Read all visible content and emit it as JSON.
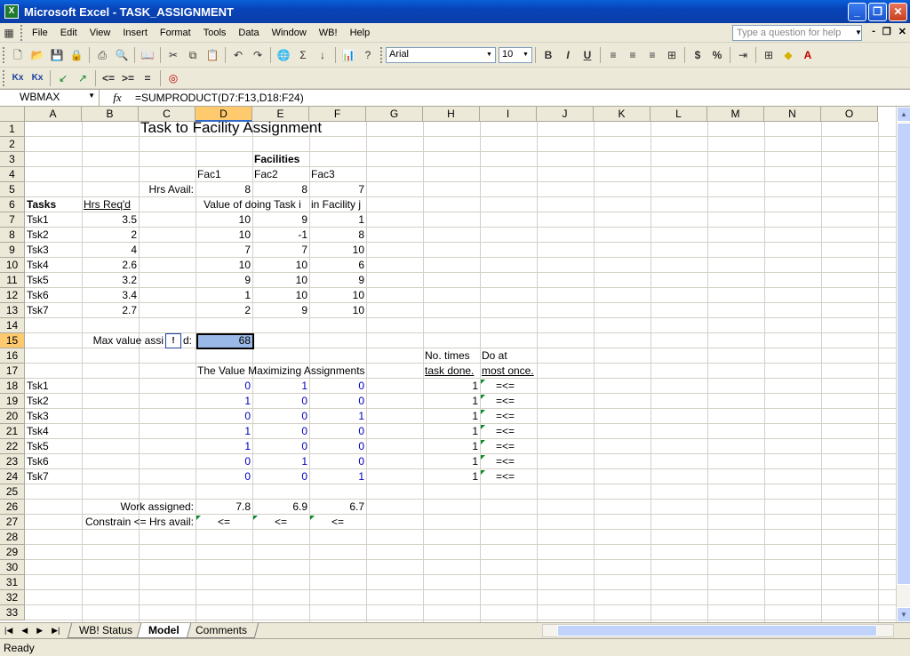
{
  "window": {
    "title": "Microsoft Excel - TASK_ASSIGNMENT"
  },
  "menu": {
    "items": [
      "File",
      "Edit",
      "View",
      "Insert",
      "Format",
      "Tools",
      "Data",
      "Window",
      "WB!",
      "Help"
    ],
    "help_placeholder": "Type a question for help"
  },
  "toolbar": {
    "font": "Arial",
    "size": "10"
  },
  "formula_bar": {
    "name_box": "WBMAX",
    "fx": "fx",
    "formula": "=SUMPRODUCT(D7:F13,D18:F24)"
  },
  "columns": [
    "A",
    "B",
    "C",
    "D",
    "E",
    "F",
    "G",
    "H",
    "I",
    "J",
    "K",
    "L",
    "M",
    "N",
    "O"
  ],
  "selected_column": "D",
  "selected_row": "15",
  "rows": [
    "1",
    "2",
    "3",
    "4",
    "5",
    "6",
    "7",
    "8",
    "9",
    "10",
    "11",
    "12",
    "13",
    "14",
    "15",
    "16",
    "17",
    "18",
    "19",
    "20",
    "21",
    "22",
    "23",
    "24",
    "25",
    "26",
    "27",
    "28",
    "29",
    "30",
    "31",
    "32",
    "33"
  ],
  "sheet": {
    "title": "Task to Facility Assignment",
    "facilities_header": "Facilities",
    "fac_names": [
      "Fac1",
      "Fac2",
      "Fac3"
    ],
    "hrs_avail_label": "Hrs Avail:",
    "hrs_avail": [
      "8",
      "8",
      "7"
    ],
    "tasks_label": "Tasks",
    "hrs_req_label": "Hrs Req'd",
    "value_header_1": "Value of doing Task i",
    "value_header_2": "in Facility j",
    "tasks": [
      "Tsk1",
      "Tsk2",
      "Tsk3",
      "Tsk4",
      "Tsk5",
      "Tsk6",
      "Tsk7"
    ],
    "hrs_req": [
      "3.5",
      "2",
      "4",
      "2.6",
      "3.2",
      "3.4",
      "2.7"
    ],
    "values": [
      [
        "10",
        "9",
        "1"
      ],
      [
        "10",
        "-1",
        "8"
      ],
      [
        "7",
        "7",
        "10"
      ],
      [
        "10",
        "10",
        "6"
      ],
      [
        "9",
        "10",
        "9"
      ],
      [
        "1",
        "10",
        "10"
      ],
      [
        "2",
        "9",
        "10"
      ]
    ],
    "max_value_label": "Max value assi",
    "max_value_label_end": "d:",
    "max_value": "68",
    "no_times_1": "No. times",
    "no_times_2": "task done.",
    "do_at_1": "Do at",
    "do_at_2": "most once.",
    "assign_header": "The Value Maximizing Assignments",
    "assignments": [
      [
        "0",
        "1",
        "0"
      ],
      [
        "1",
        "0",
        "0"
      ],
      [
        "0",
        "0",
        "1"
      ],
      [
        "1",
        "0",
        "0"
      ],
      [
        "1",
        "0",
        "0"
      ],
      [
        "0",
        "1",
        "0"
      ],
      [
        "0",
        "0",
        "1"
      ]
    ],
    "times_done": [
      "1",
      "1",
      "1",
      "1",
      "1",
      "1",
      "1"
    ],
    "le": "=<=",
    "work_assigned_label": "Work assigned:",
    "work_assigned": [
      "7.8",
      "6.9",
      "6.7"
    ],
    "constrain_label": "Constrain <= Hrs avail:",
    "constrain_ops": [
      "<=",
      "<=",
      "<="
    ]
  },
  "tabs": [
    "WB! Status",
    "Model",
    "Comments"
  ],
  "active_tab": "Model",
  "status": "Ready"
}
